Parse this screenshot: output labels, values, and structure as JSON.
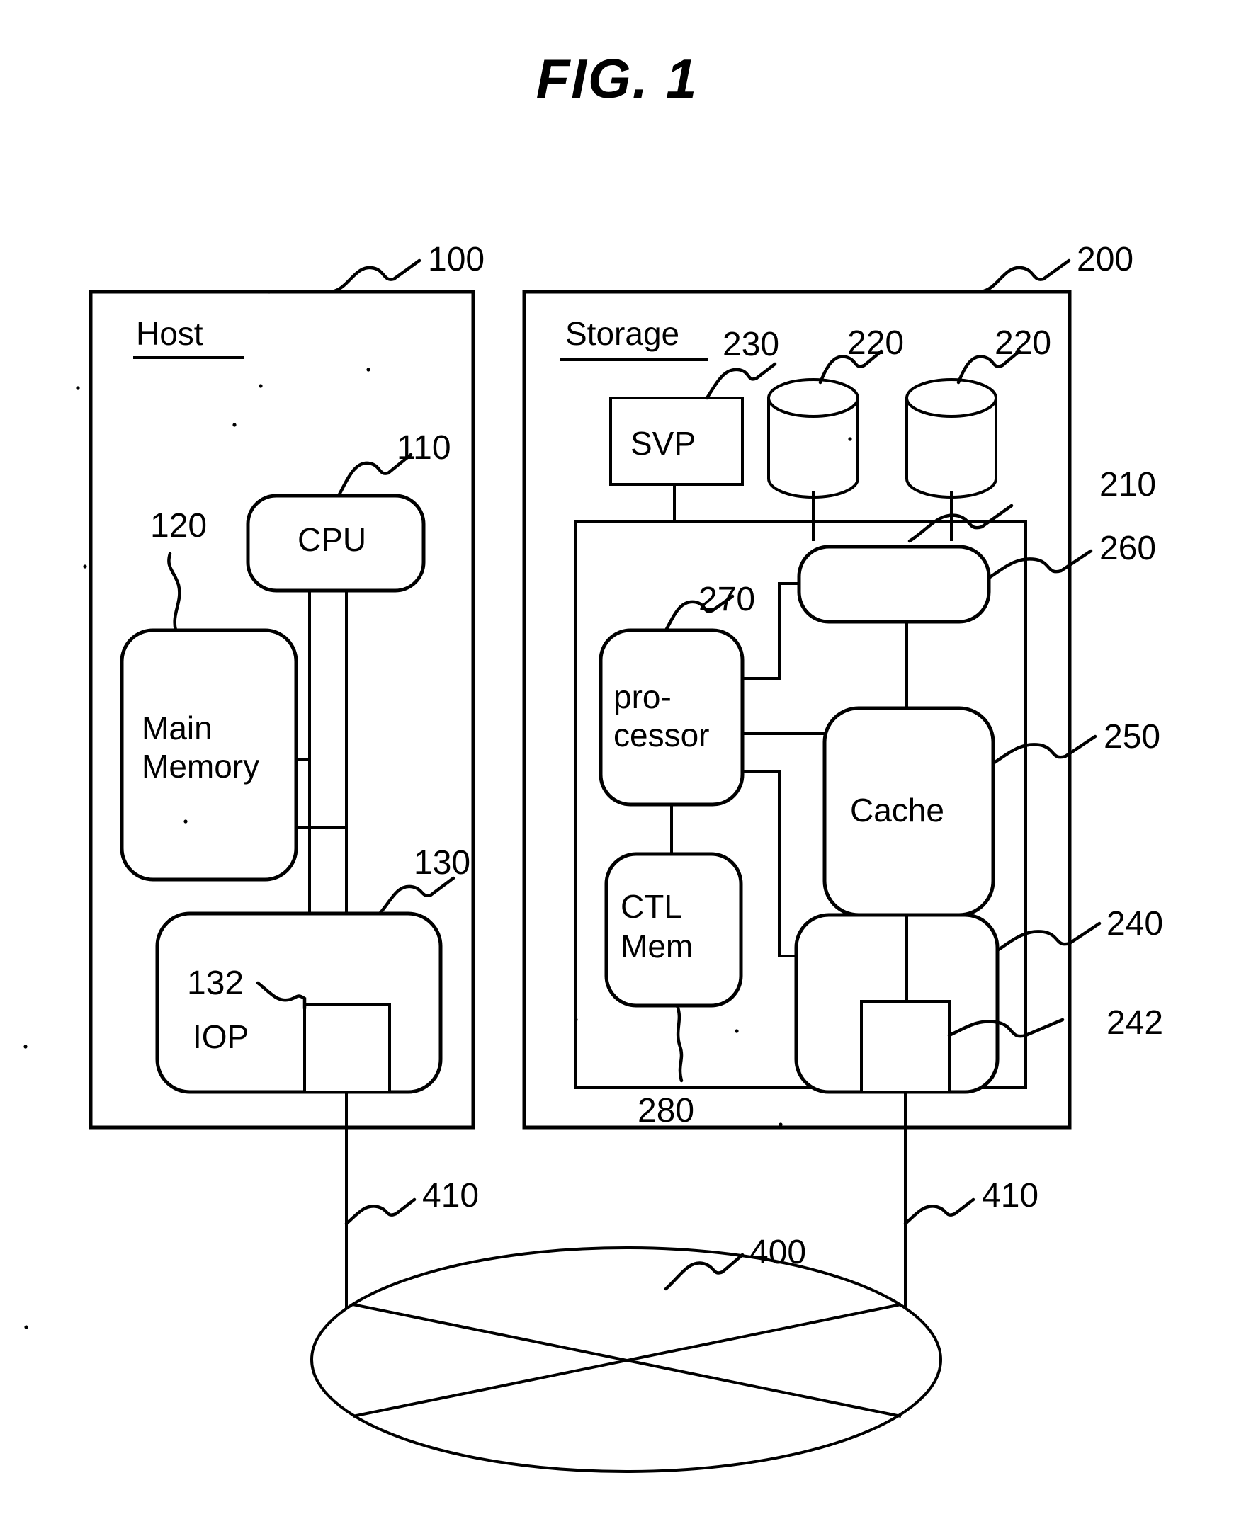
{
  "figure": {
    "title": "FIG. 1",
    "domain": "patent-diagram"
  },
  "host": {
    "header": "Host",
    "ref": "100",
    "blocks": {
      "cpu": {
        "label": "CPU",
        "ref": "110"
      },
      "main_memory": {
        "label": "Main\nMemory",
        "line1": "Main",
        "line2": "Memory",
        "ref": "120"
      },
      "iop": {
        "label": "IOP",
        "ref": "130"
      },
      "iop_port": {
        "label": "",
        "ref": "132"
      }
    }
  },
  "storage": {
    "header": "Storage",
    "ref": "200",
    "blocks": {
      "svp": {
        "label": "SVP",
        "ref": "230"
      },
      "disk_left": {
        "label": "",
        "ref": "220"
      },
      "disk_right": {
        "label": "",
        "ref": "220"
      },
      "controller": {
        "label": "",
        "ref": "210"
      },
      "disk_adapter": {
        "label": "",
        "ref": "260"
      },
      "processor": {
        "label": "pro-\ncessor",
        "line1": "pro-",
        "line2": "cessor",
        "ref": "270"
      },
      "ctl_mem": {
        "label": "CTL\nMem",
        "line1": "CTL",
        "line2": "Mem",
        "ref": "280"
      },
      "cache": {
        "label": "Cache",
        "ref": "250"
      },
      "channel_adapter": {
        "label": "",
        "ref": "240"
      },
      "channel_port": {
        "label": "",
        "ref": "242"
      }
    }
  },
  "network": {
    "cloud": {
      "label": "",
      "ref": "400"
    },
    "link_left": {
      "label": "",
      "ref": "410"
    },
    "link_right": {
      "label": "",
      "ref": "410"
    }
  },
  "colors": {
    "ink": "#000000",
    "paper": "#ffffff"
  }
}
